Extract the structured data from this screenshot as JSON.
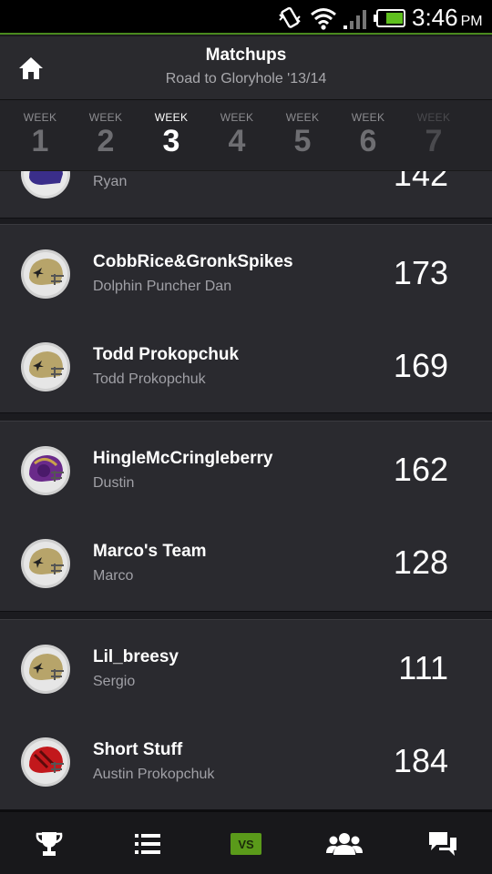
{
  "status_bar": {
    "time": "3:46",
    "ampm": "PM"
  },
  "header": {
    "title": "Matchups",
    "subtitle": "Road to Gloryhole '13/14"
  },
  "weeks": [
    {
      "label": "WEEK",
      "number": "1"
    },
    {
      "label": "WEEK",
      "number": "2"
    },
    {
      "label": "WEEK",
      "number": "3"
    },
    {
      "label": "WEEK",
      "number": "4"
    },
    {
      "label": "WEEK",
      "number": "5"
    },
    {
      "label": "WEEK",
      "number": "6"
    },
    {
      "label": "WEEK",
      "number": "7"
    }
  ],
  "selected_week": "3",
  "partial_row": {
    "owner": "Ryan",
    "score": "142",
    "helmet": "purple-helmet"
  },
  "matchups": [
    {
      "teams": [
        {
          "name": "CobbRice&GronkSpikes",
          "owner": "Dolphin Puncher Dan",
          "score": "173",
          "helmet": "gold-helmet"
        },
        {
          "name": "Todd Prokopchuk",
          "owner": "Todd Prokopchuk",
          "score": "169",
          "helmet": "gold-helmet"
        }
      ]
    },
    {
      "teams": [
        {
          "name": "HingleMcCringleberry",
          "owner": "Dustin",
          "score": "162",
          "helmet": "purple-helmet"
        },
        {
          "name": "Marco's Team",
          "owner": "Marco",
          "score": "128",
          "helmet": "gold-helmet"
        }
      ]
    },
    {
      "teams": [
        {
          "name": "Lil_breesy",
          "owner": "Sergio",
          "score": "111",
          "helmet": "gold-helmet"
        },
        {
          "name": "Short Stuff",
          "owner": "Austin Prokopchuk",
          "score": "184",
          "helmet": "red-helmet"
        }
      ]
    }
  ],
  "bottom_nav": {
    "items": [
      "trophy-icon",
      "list-icon",
      "vs-icon",
      "people-icon",
      "chat-icon"
    ],
    "vs_label": "VS"
  },
  "colors": {
    "accent": "#5a9a1a",
    "background": "#1b1b1f",
    "card": "#2a2a2f"
  }
}
